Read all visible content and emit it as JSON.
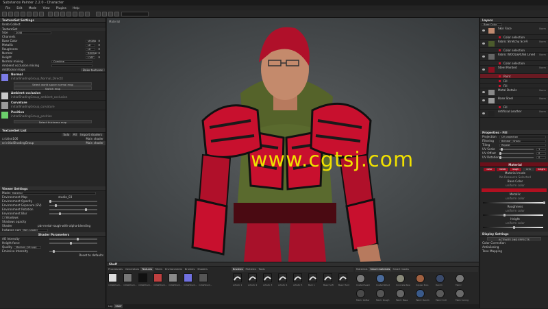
{
  "window": {
    "title": "Substance Painter 2.2.0 - Character"
  },
  "menu": [
    "File",
    "Edit",
    "Mode",
    "View",
    "Plugins",
    "Help"
  ],
  "left": {
    "textureset_settings": {
      "title": "TextureSet Settings",
      "undo_label": "Undo Collect",
      "textureset_label": "TextureSet",
      "size_label": "Size",
      "size_value": "2048",
      "channels_label": "Channels",
      "channels": [
        {
          "name": "Base Color",
          "format": "sRGB8"
        },
        {
          "name": "Metallic",
          "format": "L8"
        },
        {
          "name": "Roughness",
          "format": "L8"
        },
        {
          "name": "Normal",
          "format": "RGB16F"
        },
        {
          "name": "Height",
          "format": "L16F"
        }
      ],
      "normal_mixing_label": "Normal mixing",
      "normal_mixing_value": "Combine",
      "ao_mixing_label": "Ambient occlusion mixing",
      "additional_maps_label": "Additional maps",
      "bake_button": "Bake textures",
      "maps": [
        {
          "name": "Normal",
          "file": "initialShadingGroup_Normal_DirectX",
          "color": "#7b7be6",
          "button": "Select world space normal map"
        },
        {
          "name": "Ambient occlusion",
          "file": "initialShadingGroup_ambient_occlusion",
          "color": "#c8c8c8",
          "button": ""
        },
        {
          "name": "Curvature",
          "file": "initialShadingGroup_curvature",
          "color": "#9a9a9a",
          "button": ""
        },
        {
          "name": "Position",
          "file": "initialShadingGroup_position",
          "color": "#6bd06b",
          "button": "Select thickness map"
        }
      ],
      "switch_map": "Switch map"
    },
    "textureset_list": {
      "title": "TextureSet List",
      "buttons": [
        "Solo",
        "All",
        "Import shaders"
      ],
      "items": [
        {
          "name": "blinn106",
          "shader": "Main shader"
        },
        {
          "name": "initialShadingGroup",
          "shader": "Main shader"
        }
      ]
    },
    "viewer_settings": {
      "title": "Viewer Settings",
      "mode_label": "Mode",
      "mode_value": "Material",
      "env_map_label": "Environment Map",
      "env_map_value": "studio_03",
      "rows": [
        "Environment Opacity",
        "Environment Exposure (EV)",
        "Environment Rotation",
        "Environment Blur"
      ],
      "shadows_label": "Shadows",
      "shadows_value": "Shadows opacity",
      "shader_label": "Shader",
      "shader_value": "pbr-metal-rough-with-alpha-blending",
      "instance_label": "Instance name",
      "instance_value": "Main shader"
    },
    "shader_params": {
      "title": "Shader Parameters",
      "rows": [
        "AO Intensity",
        "Height force",
        "Quality",
        "Emissive Intensity"
      ],
      "quality_value": "Medium (16 spp)",
      "reset_button": "Reset to defaults"
    }
  },
  "viewport": {
    "label": "Material"
  },
  "watermark": "www.cgtsj.com",
  "right": {
    "layers": {
      "title": "Layers",
      "blend": "Base Color",
      "items": [
        {
          "name": "Skin Face",
          "mode": "Norm",
          "opacity": "100",
          "thumb": "#c08a70",
          "subs": [
            "Color selection"
          ]
        },
        {
          "name": "Fabric Stretchy Sci-Fi",
          "mode": "Norm",
          "opacity": "100",
          "thumb": "#4b5a2c",
          "subs": [
            "Color selection"
          ]
        },
        {
          "name": "Fabric WOOL&RUSE Lined",
          "mode": "Norm",
          "opacity": "100",
          "thumb": "#666",
          "subs": [
            "Color selection"
          ]
        },
        {
          "name": "Steel Painted",
          "mode": "Norm",
          "opacity": "100",
          "thumb": "#8a1020",
          "subs": [
            "Paint",
            "Fill",
            "Fill"
          ]
        },
        {
          "name": "Metal Details",
          "mode": "Norm",
          "opacity": "100",
          "thumb": "#888",
          "subs": []
        },
        {
          "name": "Base Steel",
          "mode": "Norm",
          "opacity": "100",
          "thumb": "#9a9a9a",
          "subs": [
            "Fill"
          ]
        },
        {
          "name": "Artificial Leather",
          "mode": "Norm",
          "opacity": "100",
          "thumb": "#222",
          "subs": []
        }
      ]
    },
    "properties": {
      "title": "Properties - Fill",
      "rows": [
        {
          "label": "Projection",
          "value": "UV projection"
        },
        {
          "label": "Filtering",
          "value": "Bilinear | Sharp"
        },
        {
          "label": "Tiling",
          "value": "Repeat"
        },
        {
          "label": "UV Scale",
          "value": "1"
        },
        {
          "label": "UV Offset",
          "value": "0"
        },
        {
          "label": "UV Rotation",
          "value": "0"
        }
      ],
      "material_label": "Material",
      "mat_buttons": [
        "color",
        "metal",
        "rough",
        "nrm",
        "height"
      ],
      "mat_active": [
        0,
        1,
        2,
        4
      ],
      "sections": [
        {
          "title": "Material mode",
          "sub": "No Resource Selected",
          "color": ""
        },
        {
          "title": "Base Color",
          "sub": "uniform color",
          "color": "#b01020"
        },
        {
          "title": "Metallic",
          "sub": "uniform color",
          "color": ""
        },
        {
          "title": "Roughness",
          "sub": "uniform color",
          "color": ""
        },
        {
          "title": "Height",
          "sub": "uniform color",
          "color": ""
        }
      ]
    },
    "display": {
      "title": "Display Settings",
      "button": "ACTIVATE 2ND EFFECTS",
      "rows": [
        "Color Correction",
        "Antialiasing",
        "Tone Mapping",
        "Glare",
        "Vignette"
      ]
    }
  },
  "bottom": {
    "shelf_title": "Shelf",
    "tabs": [
      "Procedurals",
      "Generators",
      "Textures",
      "Filters",
      "Environments",
      "Brushes",
      "Shaders"
    ],
    "active_tab": "Textures",
    "textures": [
      {
        "name": "initialShadi...",
        "color": "#ddd"
      },
      {
        "name": "initialShadi...",
        "color": "#777"
      },
      {
        "name": "initialShadi...",
        "color": "#111"
      },
      {
        "name": "initialShadi...",
        "color": "#c04040"
      },
      {
        "name": "initialShadi...",
        "color": "#8a8a8a"
      },
      {
        "name": "initialShadi...",
        "color": "#7070e0"
      },
      {
        "name": "initialShadi...",
        "color": "#555"
      }
    ],
    "brushes_tabs": [
      "Brushes",
      "Particles",
      "Tools"
    ],
    "brushes": [
      "Artistic 1",
      "Artistic 2",
      "Artistic 3",
      "Artistic 4",
      "Artistic 5",
      "Bark 1",
      "Basic Soft",
      "Basic Hard"
    ],
    "materials_tabs": [
      "Materials",
      "Smart materials",
      "Smart masks"
    ],
    "materials": [
      {
        "name": "Coated Seam",
        "color": "#7a7a7a"
      },
      {
        "name": "Coated Wood",
        "color": "#4a6a9a"
      },
      {
        "name": "Concrete Raw",
        "color": "#8a8a7a"
      },
      {
        "name": "Copper Pure",
        "color": "#a06040"
      },
      {
        "name": "Denim",
        "color": "#3a4a6a"
      },
      {
        "name": "Fabric",
        "color": "#777"
      },
      {
        "name": "Fabric Glitter",
        "color": "#4a4a4a"
      },
      {
        "name": "Fabric Rough",
        "color": "#555"
      },
      {
        "name": "Fabric Base",
        "color": "#666"
      },
      {
        "name": "Fabric Denim",
        "color": "#3a5a8a"
      },
      {
        "name": "Fabric Knit",
        "color": "#5a5a5a"
      },
      {
        "name": "Fabric Lining",
        "color": "#6a6a6a"
      }
    ],
    "footer_tabs": [
      "Log",
      "Shelf"
    ]
  }
}
